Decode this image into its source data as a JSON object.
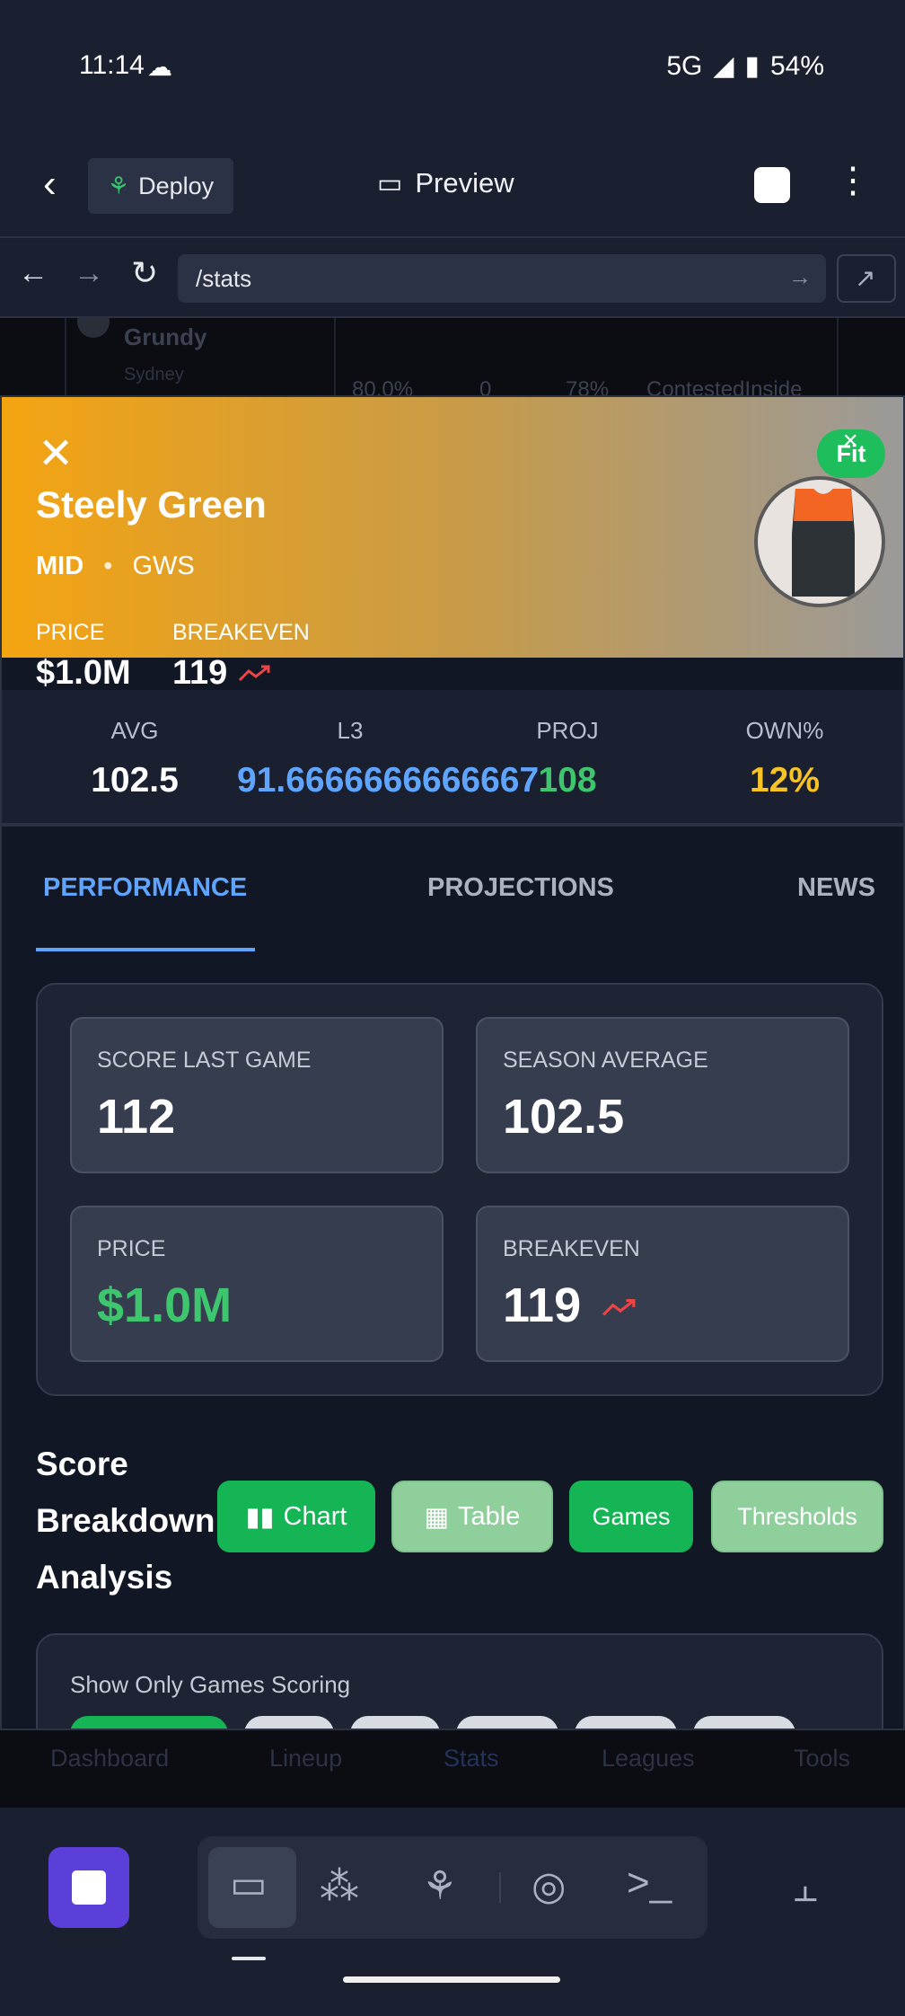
{
  "status_bar": {
    "time": "11:14",
    "network": "5G",
    "battery": "54%"
  },
  "header": {
    "deploy_label": "Deploy",
    "preview_label": "Preview"
  },
  "url_bar": {
    "path": "/stats"
  },
  "background_page": {
    "player": "Grundy",
    "team": "Sydney",
    "cols": [
      "80.0%",
      "0",
      "78%",
      "ContestedInside"
    ]
  },
  "player": {
    "name": "Steely Green",
    "position": "MID",
    "team": "GWS",
    "status": "Fit",
    "price_label": "PRICE",
    "price": "$1.0M",
    "breakeven_label": "BREAKEVEN",
    "breakeven": "119"
  },
  "stats": [
    {
      "label": "AVG",
      "value": "102.5",
      "color": "#ffffff"
    },
    {
      "label": "L3",
      "value": "91.6666666666667",
      "color": "#5fa5ff"
    },
    {
      "label": "PROJ",
      "value": "108",
      "color": "#3ec66f"
    },
    {
      "label": "OWN%",
      "value": "12%",
      "color": "#f7c325"
    }
  ],
  "tabs": [
    {
      "label": "PERFORMANCE",
      "active": true
    },
    {
      "label": "PROJECTIONS",
      "active": false
    },
    {
      "label": "NEWS",
      "active": false
    }
  ],
  "summary_cards": {
    "last_game": {
      "label": "SCORE LAST GAME",
      "value": "112"
    },
    "season_avg": {
      "label": "SEASON AVERAGE",
      "value": "102.5"
    },
    "price": {
      "label": "PRICE",
      "value": "$1.0M",
      "color": "#3ec66f"
    },
    "breakeven": {
      "label": "BREAKEVEN",
      "value": "119"
    }
  },
  "breakdown": {
    "title": "Score Breakdown Analysis",
    "buttons": [
      "Chart",
      "Table",
      "Games",
      "Thresholds"
    ],
    "filter_label": "Show Only Games Scoring"
  },
  "app_nav": [
    "Dashboard",
    "Lineup",
    "Stats",
    "Leagues",
    "Tools"
  ],
  "colors": {
    "accent": "#5fa5ff",
    "green": "#15b555",
    "orange": "#f4a411",
    "purple": "#5b3fd8"
  }
}
